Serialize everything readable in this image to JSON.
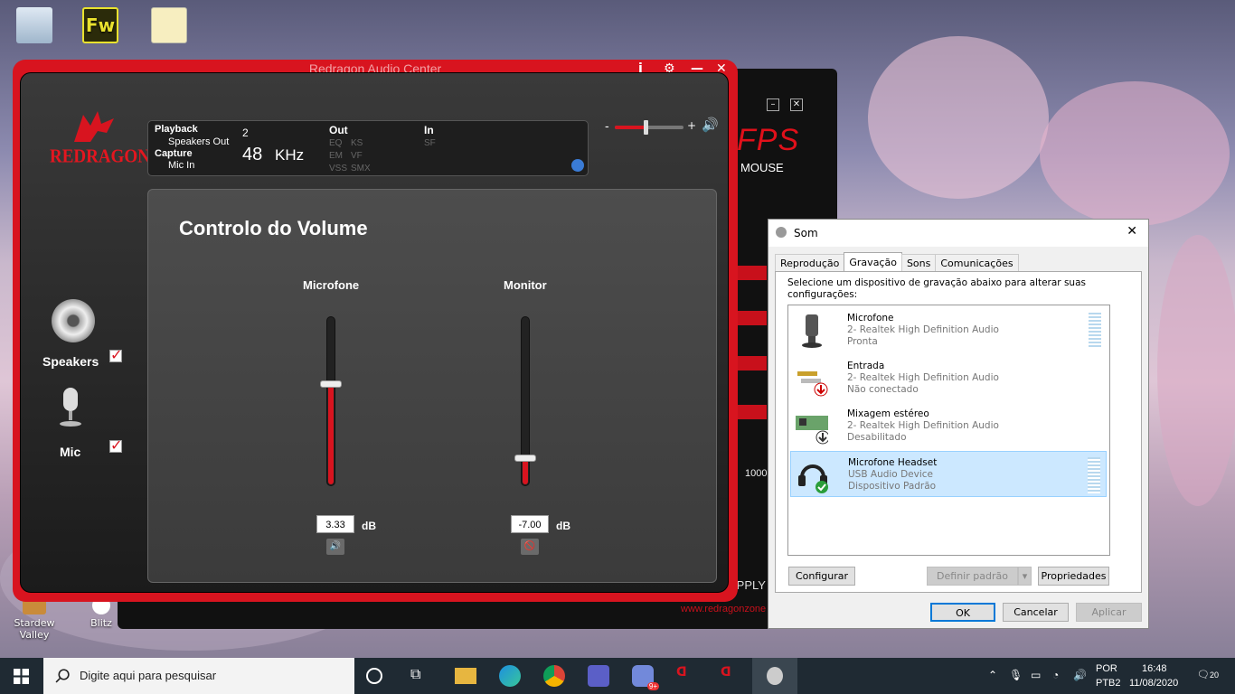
{
  "desktop": {
    "icons": [
      {
        "label": ""
      },
      {
        "label": ""
      },
      {
        "label": ""
      },
      {
        "label": "Stardew Valley"
      },
      {
        "label": "Blitz"
      }
    ]
  },
  "back_window": {
    "brand": "FPS",
    "mouse_label": "MOUSE",
    "apply_label": "APPLY",
    "site": "www.redragonzone",
    "value_1000": "1000"
  },
  "audio_center": {
    "title": "Redragon Audio Center",
    "logo_text": "REDRAGON",
    "info": {
      "playback_label": "Playback",
      "playback_device": "Speakers Out",
      "capture_label": "Capture",
      "capture_device": "Mic In",
      "channel": "2",
      "rate": "48",
      "rate_unit": "KHz",
      "out_label": "Out",
      "in_label": "In",
      "out_opts": [
        "EQ",
        "KS",
        "EM",
        "VF",
        "VSS",
        "SMX"
      ],
      "in_opts": [
        "SF"
      ]
    },
    "panel_title": "Controlo do Volume",
    "sliders": [
      {
        "label": "Microfone",
        "value": "3.33",
        "unit": "dB",
        "level": 0.6
      },
      {
        "label": "Monitor",
        "value": "-7.00",
        "unit": "dB",
        "level": 0.16
      }
    ],
    "master_level": 0.45,
    "sidebar": [
      {
        "label": "Speakers",
        "checked": true
      },
      {
        "label": "Mic",
        "checked": true
      }
    ],
    "accent": "#d8141f"
  },
  "sound_dialog": {
    "title": "Som",
    "tabs": [
      "Reprodução",
      "Gravação",
      "Sons",
      "Comunicações"
    ],
    "active_tab": "Gravação",
    "instruction": "Selecione um dispositivo de gravação abaixo para alterar suas configurações:",
    "devices": [
      {
        "name": "Microfone",
        "driver": "2- Realtek High Definition Audio",
        "status": "Pronta",
        "icon": "microphone-icon"
      },
      {
        "name": "Entrada",
        "driver": "2- Realtek High Definition Audio",
        "status": "Não conectado",
        "icon": "line-in-icon"
      },
      {
        "name": "Mixagem estéreo",
        "driver": "2- Realtek High Definition Audio",
        "status": "Desabilitado",
        "icon": "sound-card-icon"
      },
      {
        "name": "Microfone Headset",
        "driver": "USB Audio Device",
        "status": "Dispositivo Padrão",
        "icon": "headset-icon"
      }
    ],
    "buttons": {
      "configure": "Configurar",
      "set_default": "Definir padrão",
      "properties": "Propriedades",
      "ok": "OK",
      "cancel": "Cancelar",
      "apply": "Aplicar"
    }
  },
  "taskbar": {
    "search_placeholder": "Digite aqui para pesquisar",
    "lang": "POR",
    "layout": "PTB2",
    "time": "16:48",
    "date": "11/08/2020",
    "notifications": "20",
    "discord_badge": "9+"
  }
}
